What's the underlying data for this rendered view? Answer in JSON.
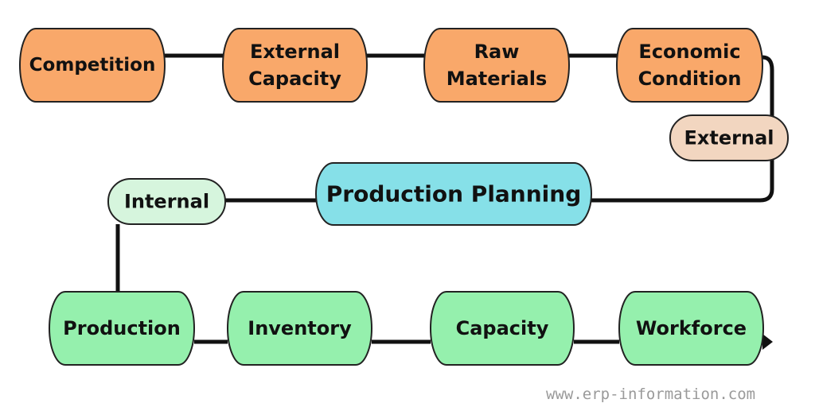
{
  "colors": {
    "external_factor": "#f9a86a",
    "internal_factor": "#95f0ad",
    "center": "#86e0e8",
    "external_tag": "#f2d6c0",
    "internal_tag": "#d6f5dd",
    "line": "#111111"
  },
  "external_factors": [
    "Competition",
    "External Capacity",
    "Raw Materials",
    "Economic Condition"
  ],
  "external_tag": "External",
  "center": "Production Planning",
  "internal_tag": "Internal",
  "internal_factors": [
    "Production",
    "Inventory",
    "Capacity",
    "Workforce"
  ],
  "watermark": "www.erp-information.com"
}
